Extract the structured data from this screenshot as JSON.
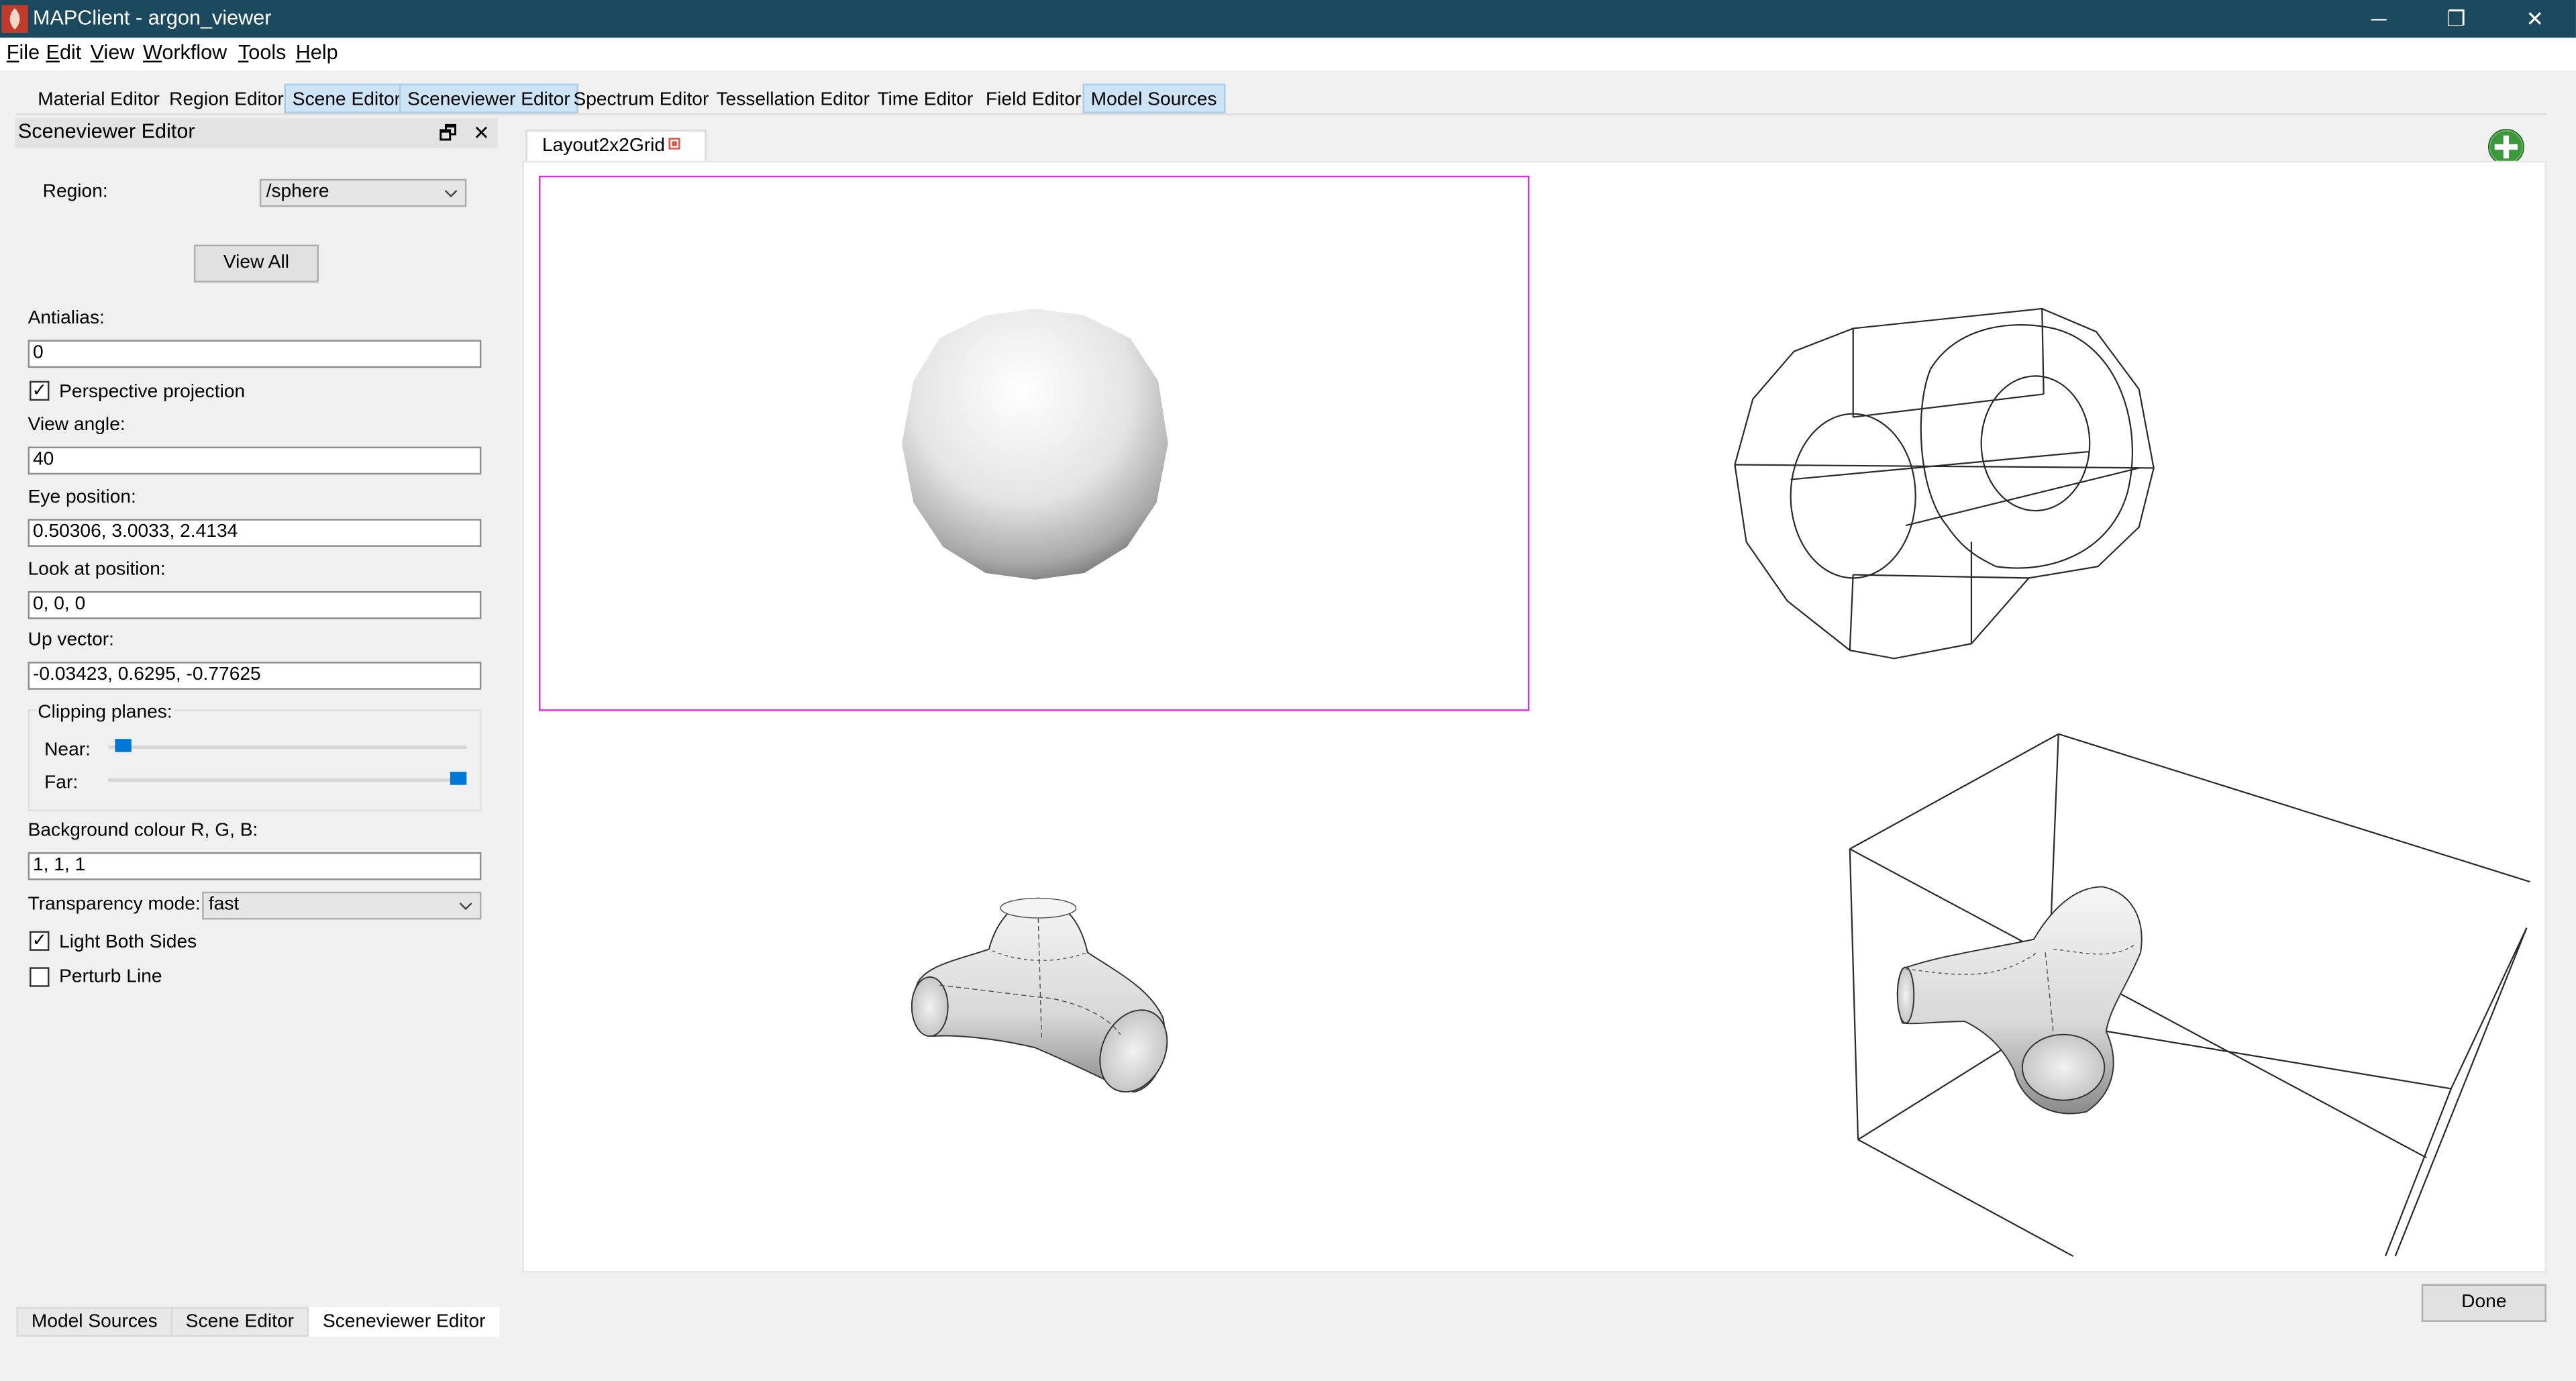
{
  "window": {
    "title": "MAPClient - argon_viewer",
    "minimize_glyph": "─",
    "restore_glyph": "❐",
    "close_glyph": "✕"
  },
  "menu": [
    "File",
    "Edit",
    "View",
    "Workflow",
    "Tools",
    "Help"
  ],
  "toolbar": [
    {
      "label": "Material Editor",
      "active": false
    },
    {
      "label": "Region Editor",
      "active": false
    },
    {
      "label": "Scene Editor",
      "active": true
    },
    {
      "label": "Sceneviewer Editor",
      "active": true
    },
    {
      "label": "Spectrum Editor",
      "active": false
    },
    {
      "label": "Tessellation Editor",
      "active": false
    },
    {
      "label": "Time Editor",
      "active": false
    },
    {
      "label": "Field Editor",
      "active": false
    },
    {
      "label": "Model Sources",
      "active": true
    }
  ],
  "dock": {
    "title": "Sceneviewer Editor",
    "float_glyph": "🗗",
    "close_glyph": "✕",
    "region_label": "Region:",
    "region_value": "/sphere",
    "view_all": "View All",
    "antialias_label": "Antialias:",
    "antialias_value": "0",
    "perspective_label": "Perspective projection",
    "perspective_checked": true,
    "view_angle_label": "View angle:",
    "view_angle_value": "40",
    "eye_label": "Eye position:",
    "eye_value": "0.50306, 3.0033, 2.4134",
    "lookat_label": "Look at position:",
    "lookat_value": "0, 0, 0",
    "up_label": "Up vector:",
    "up_value": "-0.03423, 0.6295, -0.77625",
    "clipping_label": "Clipping planes:",
    "near_label": "Near:",
    "near_value": 0.02,
    "far_label": "Far:",
    "far_value": 1.0,
    "bg_label": "Background colour R, G, B:",
    "bg_value": "1, 1, 1",
    "transparency_label": "Transparency mode:",
    "transparency_value": "fast",
    "light_both_label": "Light Both Sides",
    "light_both_checked": true,
    "perturb_label": "Perturb Line",
    "perturb_checked": false,
    "check_glyph": "✓"
  },
  "central": {
    "tab_label": "Layout2x2Grid",
    "add_icon": "add-view-icon"
  },
  "bottom_tabs": [
    {
      "label": "Model Sources",
      "active": false
    },
    {
      "label": "Scene Editor",
      "active": false
    },
    {
      "label": "Sceneviewer Editor",
      "active": true
    }
  ],
  "done_button": "Done",
  "colors": {
    "titlebar": "#1b4a5e",
    "accent": "#0078d7",
    "selection": "#e22be2",
    "highlight": "#cde4f7"
  }
}
